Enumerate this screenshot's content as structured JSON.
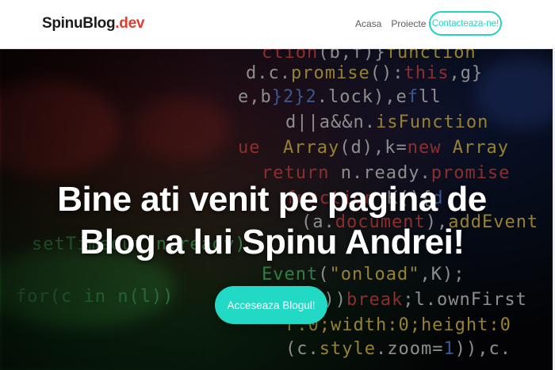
{
  "navbar": {
    "brand_main": "SpinuBlog",
    "brand_accent": ".dev",
    "links": [
      {
        "label": "Acasa"
      },
      {
        "label": "Proiecte"
      }
    ],
    "cta_label": "Contacteaza-ne!"
  },
  "hero": {
    "title_line1": "Bine ati venit pe pagina de",
    "title_line2": "Blog a lui Spinu Andrei!",
    "cta_label": "Acceseaza Blogul!"
  },
  "colors": {
    "accent": "#24d3c0",
    "brand_accent": "#e53a2f",
    "hero_button": "#21d9c4"
  }
}
